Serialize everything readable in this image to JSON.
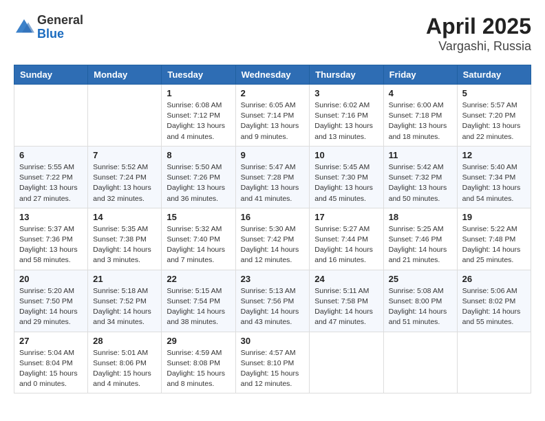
{
  "header": {
    "logo_general": "General",
    "logo_blue": "Blue",
    "title": "April 2025",
    "subtitle": "Vargashi, Russia"
  },
  "weekdays": [
    "Sunday",
    "Monday",
    "Tuesday",
    "Wednesday",
    "Thursday",
    "Friday",
    "Saturday"
  ],
  "weeks": [
    [
      null,
      null,
      {
        "day": 1,
        "sunrise": "6:08 AM",
        "sunset": "7:12 PM",
        "daylight": "13 hours and 4 minutes."
      },
      {
        "day": 2,
        "sunrise": "6:05 AM",
        "sunset": "7:14 PM",
        "daylight": "13 hours and 9 minutes."
      },
      {
        "day": 3,
        "sunrise": "6:02 AM",
        "sunset": "7:16 PM",
        "daylight": "13 hours and 13 minutes."
      },
      {
        "day": 4,
        "sunrise": "6:00 AM",
        "sunset": "7:18 PM",
        "daylight": "13 hours and 18 minutes."
      },
      {
        "day": 5,
        "sunrise": "5:57 AM",
        "sunset": "7:20 PM",
        "daylight": "13 hours and 22 minutes."
      }
    ],
    [
      {
        "day": 6,
        "sunrise": "5:55 AM",
        "sunset": "7:22 PM",
        "daylight": "13 hours and 27 minutes."
      },
      {
        "day": 7,
        "sunrise": "5:52 AM",
        "sunset": "7:24 PM",
        "daylight": "13 hours and 32 minutes."
      },
      {
        "day": 8,
        "sunrise": "5:50 AM",
        "sunset": "7:26 PM",
        "daylight": "13 hours and 36 minutes."
      },
      {
        "day": 9,
        "sunrise": "5:47 AM",
        "sunset": "7:28 PM",
        "daylight": "13 hours and 41 minutes."
      },
      {
        "day": 10,
        "sunrise": "5:45 AM",
        "sunset": "7:30 PM",
        "daylight": "13 hours and 45 minutes."
      },
      {
        "day": 11,
        "sunrise": "5:42 AM",
        "sunset": "7:32 PM",
        "daylight": "13 hours and 50 minutes."
      },
      {
        "day": 12,
        "sunrise": "5:40 AM",
        "sunset": "7:34 PM",
        "daylight": "13 hours and 54 minutes."
      }
    ],
    [
      {
        "day": 13,
        "sunrise": "5:37 AM",
        "sunset": "7:36 PM",
        "daylight": "13 hours and 58 minutes."
      },
      {
        "day": 14,
        "sunrise": "5:35 AM",
        "sunset": "7:38 PM",
        "daylight": "14 hours and 3 minutes."
      },
      {
        "day": 15,
        "sunrise": "5:32 AM",
        "sunset": "7:40 PM",
        "daylight": "14 hours and 7 minutes."
      },
      {
        "day": 16,
        "sunrise": "5:30 AM",
        "sunset": "7:42 PM",
        "daylight": "14 hours and 12 minutes."
      },
      {
        "day": 17,
        "sunrise": "5:27 AM",
        "sunset": "7:44 PM",
        "daylight": "14 hours and 16 minutes."
      },
      {
        "day": 18,
        "sunrise": "5:25 AM",
        "sunset": "7:46 PM",
        "daylight": "14 hours and 21 minutes."
      },
      {
        "day": 19,
        "sunrise": "5:22 AM",
        "sunset": "7:48 PM",
        "daylight": "14 hours and 25 minutes."
      }
    ],
    [
      {
        "day": 20,
        "sunrise": "5:20 AM",
        "sunset": "7:50 PM",
        "daylight": "14 hours and 29 minutes."
      },
      {
        "day": 21,
        "sunrise": "5:18 AM",
        "sunset": "7:52 PM",
        "daylight": "14 hours and 34 minutes."
      },
      {
        "day": 22,
        "sunrise": "5:15 AM",
        "sunset": "7:54 PM",
        "daylight": "14 hours and 38 minutes."
      },
      {
        "day": 23,
        "sunrise": "5:13 AM",
        "sunset": "7:56 PM",
        "daylight": "14 hours and 43 minutes."
      },
      {
        "day": 24,
        "sunrise": "5:11 AM",
        "sunset": "7:58 PM",
        "daylight": "14 hours and 47 minutes."
      },
      {
        "day": 25,
        "sunrise": "5:08 AM",
        "sunset": "8:00 PM",
        "daylight": "14 hours and 51 minutes."
      },
      {
        "day": 26,
        "sunrise": "5:06 AM",
        "sunset": "8:02 PM",
        "daylight": "14 hours and 55 minutes."
      }
    ],
    [
      {
        "day": 27,
        "sunrise": "5:04 AM",
        "sunset": "8:04 PM",
        "daylight": "15 hours and 0 minutes."
      },
      {
        "day": 28,
        "sunrise": "5:01 AM",
        "sunset": "8:06 PM",
        "daylight": "15 hours and 4 minutes."
      },
      {
        "day": 29,
        "sunrise": "4:59 AM",
        "sunset": "8:08 PM",
        "daylight": "15 hours and 8 minutes."
      },
      {
        "day": 30,
        "sunrise": "4:57 AM",
        "sunset": "8:10 PM",
        "daylight": "15 hours and 12 minutes."
      },
      null,
      null,
      null
    ]
  ]
}
